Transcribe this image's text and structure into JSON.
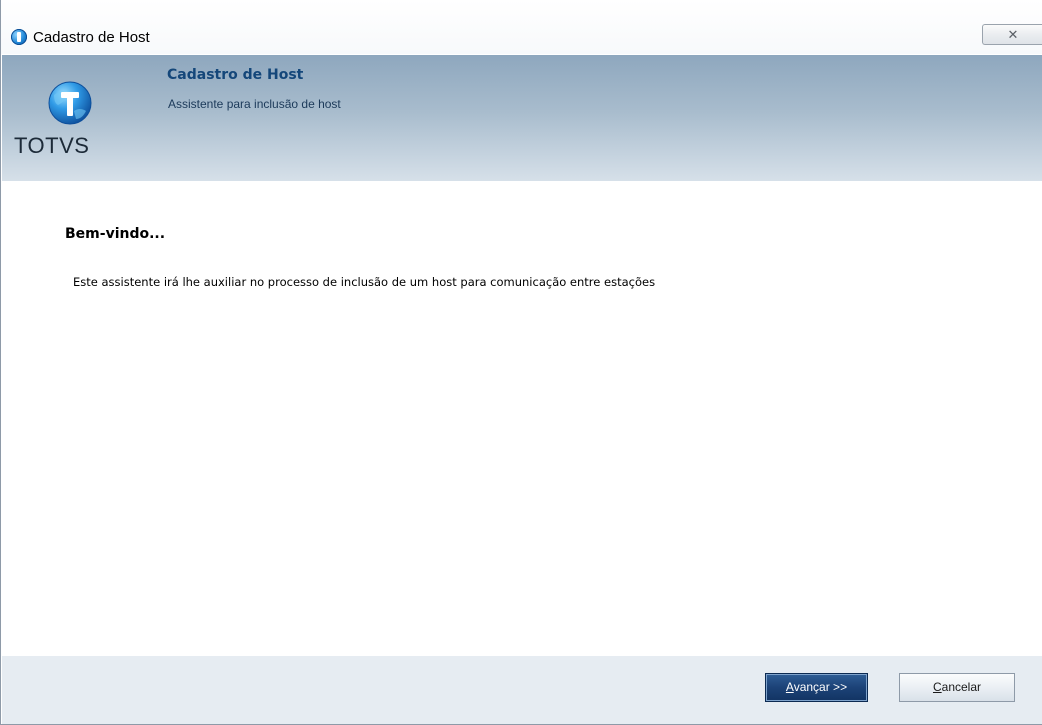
{
  "window": {
    "title": "Cadastro de Host",
    "close_label": "✕"
  },
  "header": {
    "logo_text": "TOTVS",
    "title": "Cadastro de Host",
    "subtitle": "Assistente para inclusão de host"
  },
  "content": {
    "heading": "Bem-vindo...",
    "description": "Este assistente irá lhe auxiliar no processo de inclusão de um host para comunicação entre estações"
  },
  "footer": {
    "next_accel": "A",
    "next_rest": "vançar >>",
    "cancel_accel": "C",
    "cancel_rest": "ancelar"
  },
  "colors": {
    "header_title": "#14477a",
    "primary_button": "#1c4277",
    "header_gradient_top": "#8ea7be",
    "footer_bg": "#e6ecf2"
  }
}
